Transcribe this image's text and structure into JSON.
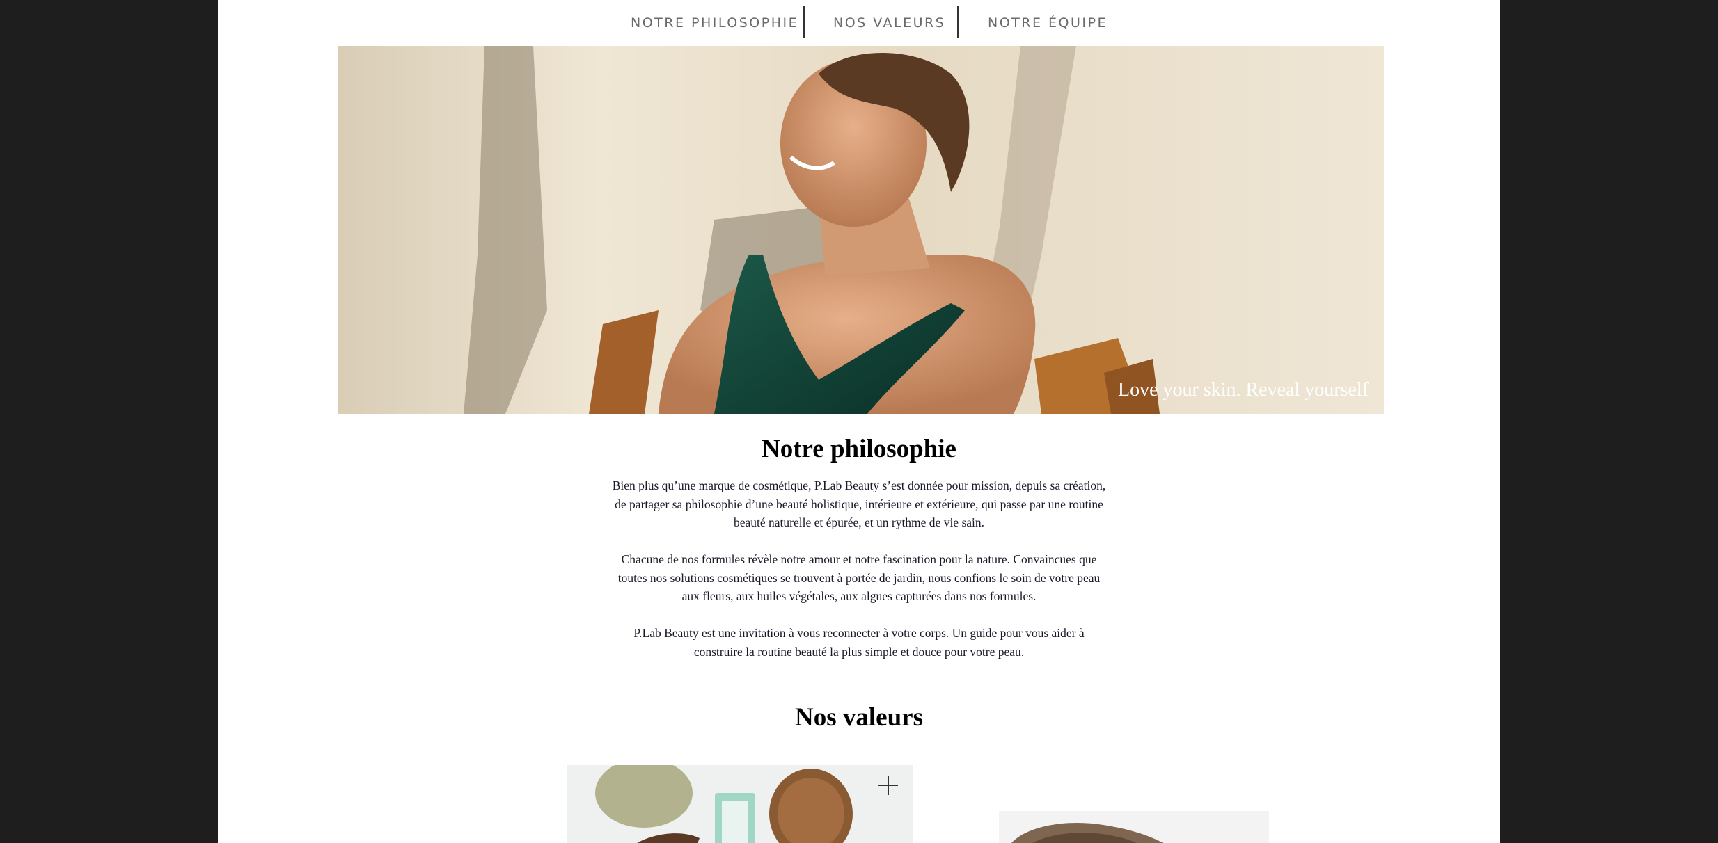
{
  "nav": {
    "items": [
      {
        "label": "NOTRE PHILOSOPHIE"
      },
      {
        "label": "NOS VALEURS"
      },
      {
        "label": "NOTRE ÉQUIPE"
      }
    ]
  },
  "hero": {
    "caption": "Love your skin. Reveal yourself"
  },
  "philosophy": {
    "title": "Notre philosophie",
    "paragraphs": [
      [
        "Bien plus qu’une marque de cosmétique, P.Lab Beauty s’est donnée pour mission, depuis sa création,",
        "de partager sa philosophie d’une beauté holistique, intérieure et extérieure, qui passe par une routine",
        "beauté naturelle et épurée, et un rythme de vie sain."
      ],
      [
        "Chacune de nos formules révèle notre amour et notre fascination pour la nature. Convaincues que",
        "toutes nos solutions cosmétiques se trouvent à portée de jardin, nous confions le soin de votre peau",
        "aux fleurs, aux huiles végétales, aux algues capturées dans nos formules."
      ],
      [
        "P.Lab Beauty est une invitation à vous reconnecter à votre corps. Un guide pour vous aider à",
        "construire la routine beauté la plus simple et douce pour votre peau."
      ]
    ]
  },
  "values": {
    "title": "Nos valeurs"
  },
  "colors": {
    "backdrop": "#1e1e1e",
    "page": "#ffffff",
    "nav_text": "#6a6a6a",
    "dress": "#0f3d33"
  }
}
